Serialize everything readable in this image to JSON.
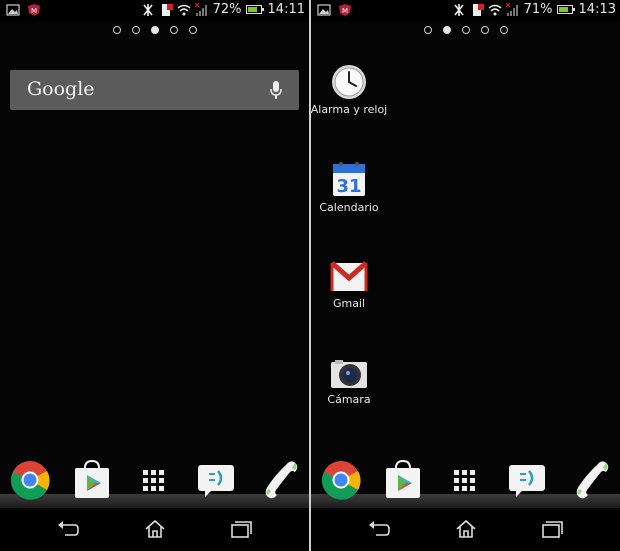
{
  "screens": [
    {
      "status": {
        "battery": "72%",
        "time": "14:11"
      },
      "page_indicator": {
        "count": 5,
        "active": 3
      },
      "search": {
        "brand": "Google"
      },
      "dock": [
        "chrome-icon",
        "play-store-icon",
        "app-drawer-icon",
        "messaging-icon",
        "phone-icon"
      ],
      "nav": [
        "back-icon",
        "home-icon",
        "recents-icon"
      ]
    },
    {
      "status": {
        "battery": "71%",
        "time": "14:13"
      },
      "page_indicator": {
        "count": 5,
        "active": 2
      },
      "apps": [
        {
          "label": "Alarma y reloj",
          "icon": "clock-icon"
        },
        {
          "label": "Calendario",
          "icon": "calendar-icon",
          "day": "31"
        },
        {
          "label": "Gmail",
          "icon": "gmail-icon"
        },
        {
          "label": "Cámara",
          "icon": "camera-icon"
        }
      ],
      "dock": [
        "chrome-icon",
        "play-store-icon",
        "app-drawer-icon",
        "messaging-icon",
        "phone-icon"
      ],
      "nav": [
        "back-icon",
        "home-icon",
        "recents-icon"
      ]
    }
  ],
  "colors": {
    "battery_fill": "#7ccb2b",
    "search_bar": "#5b5b5b",
    "background": "#050505"
  }
}
